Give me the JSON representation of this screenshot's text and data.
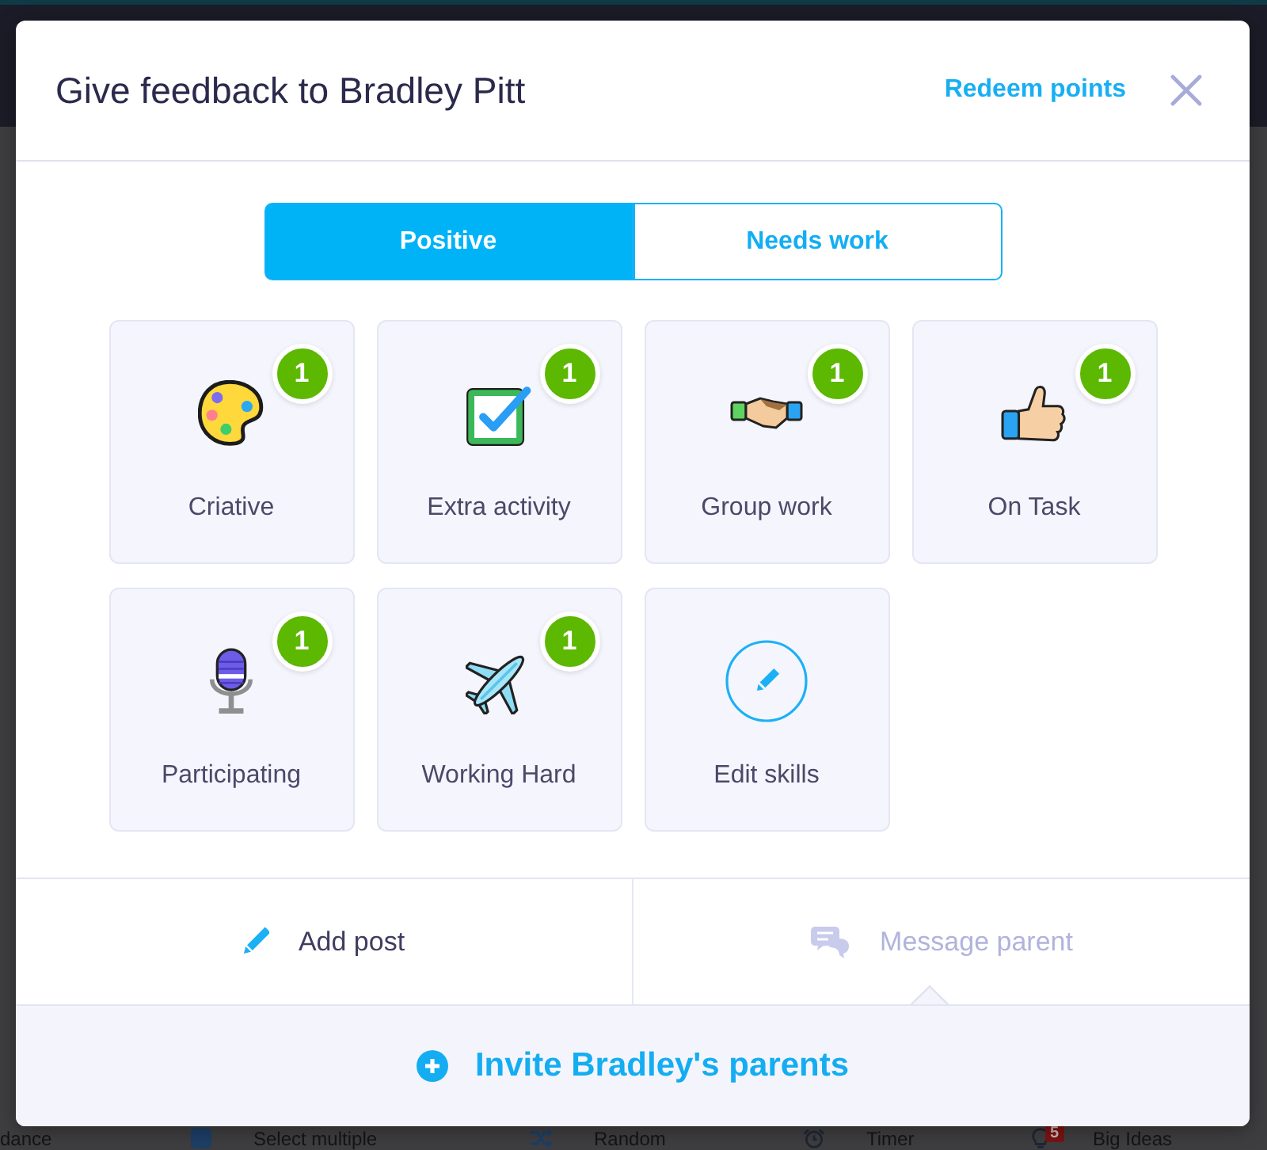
{
  "dialog": {
    "title": "Give feedback to Bradley Pitt",
    "link": "Redeem points"
  },
  "tabs": [
    {
      "label": "Positive",
      "selected": true
    },
    {
      "label": "Needs work",
      "selected": false
    }
  ],
  "skills": [
    {
      "kind": "skill",
      "label": "Criative",
      "count": "1"
    },
    {
      "kind": "skill",
      "label": "Extra activity",
      "count": "1"
    },
    {
      "kind": "skill",
      "label": "Group work",
      "count": "1"
    },
    {
      "kind": "skill",
      "label": "On Task",
      "count": "1"
    },
    {
      "kind": "skill",
      "label": "Participating",
      "count": "1"
    },
    {
      "kind": "skill",
      "label": "Working Hard",
      "count": "1"
    },
    {
      "kind": "edit",
      "label": "Edit skills"
    }
  ],
  "actions": [
    {
      "label": "Add post",
      "disabled": false,
      "expanded": false
    },
    {
      "label": "Message parent",
      "disabled": true,
      "expanded": true
    }
  ],
  "invite": {
    "label": "Invite Bradley's parents"
  },
  "background_toolbar": [
    {
      "label": "dance"
    },
    {
      "label": "Select multiple"
    },
    {
      "label": "Random"
    },
    {
      "label": "Timer"
    },
    {
      "label": "Big Ideas",
      "badge": "5"
    }
  ]
}
